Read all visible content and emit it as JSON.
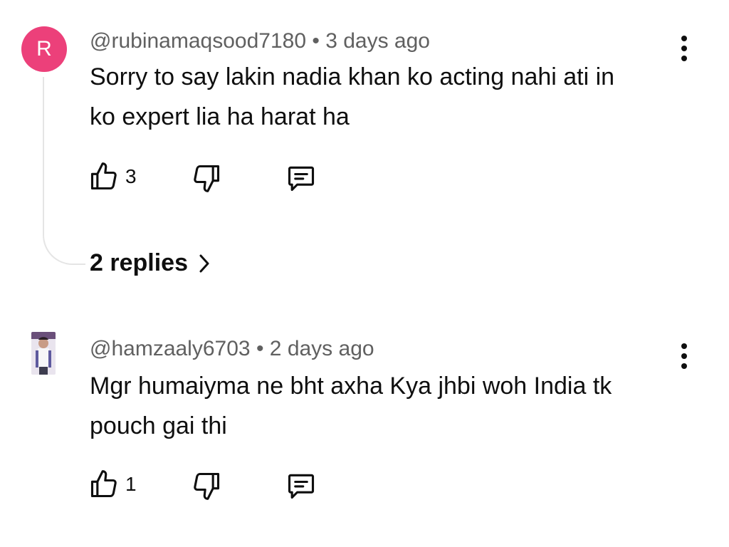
{
  "comments": [
    {
      "avatar_letter": "R",
      "author": "@rubinamaqsood7180",
      "separator": "•",
      "time": "3 days ago",
      "text_line1": "Sorry to say lakin nadia khan ko acting nahi ati in",
      "text_line2": "ko expert lia ha harat ha",
      "like_count": "3",
      "replies_label": "2 replies"
    },
    {
      "author": "@hamzaaly6703",
      "separator": "•",
      "time": "2 days ago",
      "text_line1": "Mgr humaiyma ne bht axha Kya jhbi woh India tk",
      "text_line2": "pouch gai thi",
      "like_count": "1"
    }
  ],
  "icons": {
    "like": "thumbs-up-icon",
    "dislike": "thumbs-down-icon",
    "reply": "reply-comment-icon",
    "more": "more-vertical-icon",
    "chevron": "chevron-right-icon"
  },
  "colors": {
    "avatar_bg": "#ec407a",
    "meta_text": "#606060",
    "primary_text": "#0f0f0f",
    "thread_line": "#e5e5e5"
  }
}
